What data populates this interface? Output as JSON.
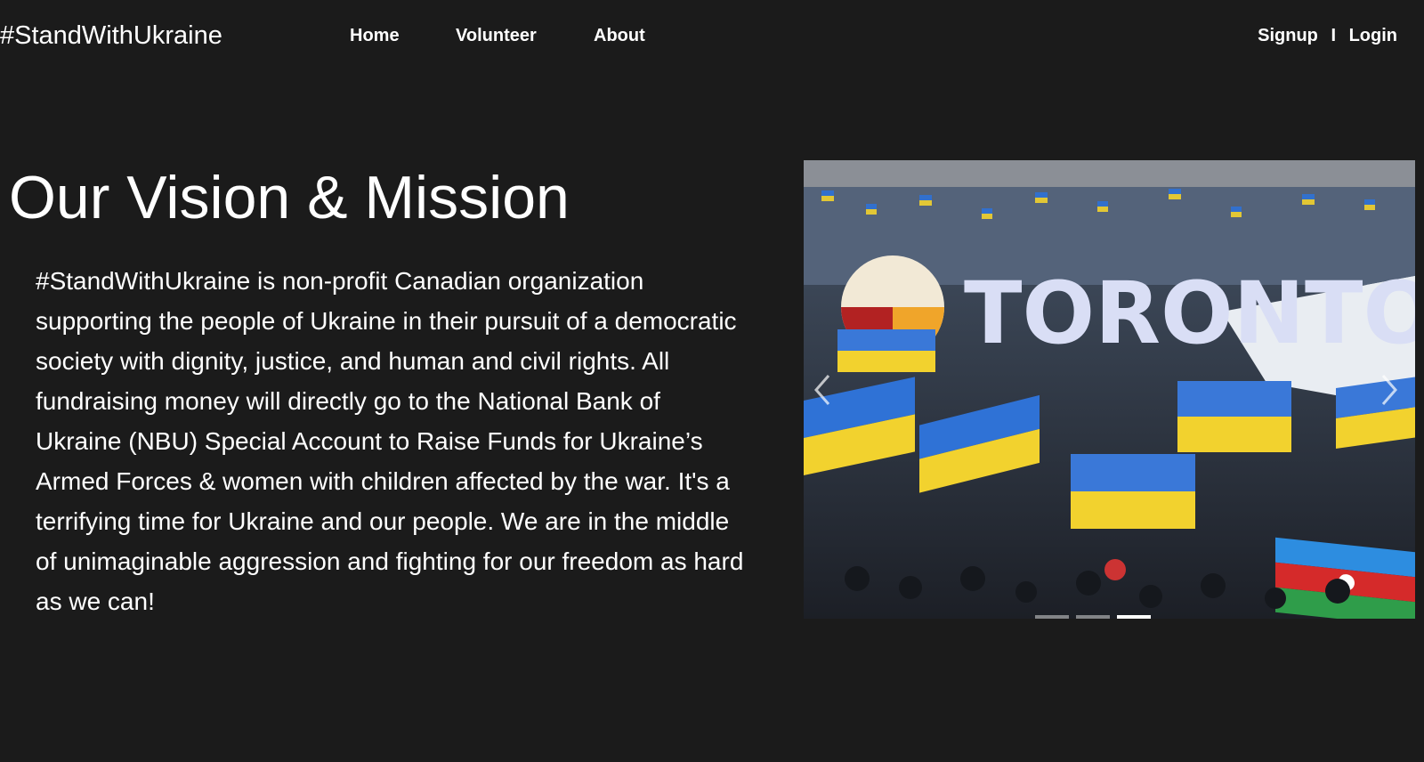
{
  "navbar": {
    "brand": "#StandWithUkraine",
    "links": [
      "Home",
      "Volunteer",
      "About"
    ],
    "signup": "Signup",
    "separator": "I",
    "login": "Login"
  },
  "hero": {
    "title": "Our Vision & Mission",
    "description": "#StandWithUkraine is non-profit Canadian organization supporting the people of Ukraine in their pursuit of a democratic society with dignity, justice, and human and civil rights. All fundraising money will directly go to the National Bank of Ukraine (NBU) Special Account to Raise Funds for Ukraine’s Armed Forces & women with children affected by the war. It's a terrifying time for Ukraine and our people. We are in the middle of unimaginable aggression and fighting for our freedom as hard as we can!"
  },
  "carousel": {
    "image_sign_text": "TORONTO",
    "slide_count": 3,
    "active_slide": 3
  },
  "colors": {
    "background": "#1b1b1b",
    "text": "#ffffff",
    "flag_blue": "#1f6fd1",
    "flag_yellow": "#f2d22e"
  }
}
